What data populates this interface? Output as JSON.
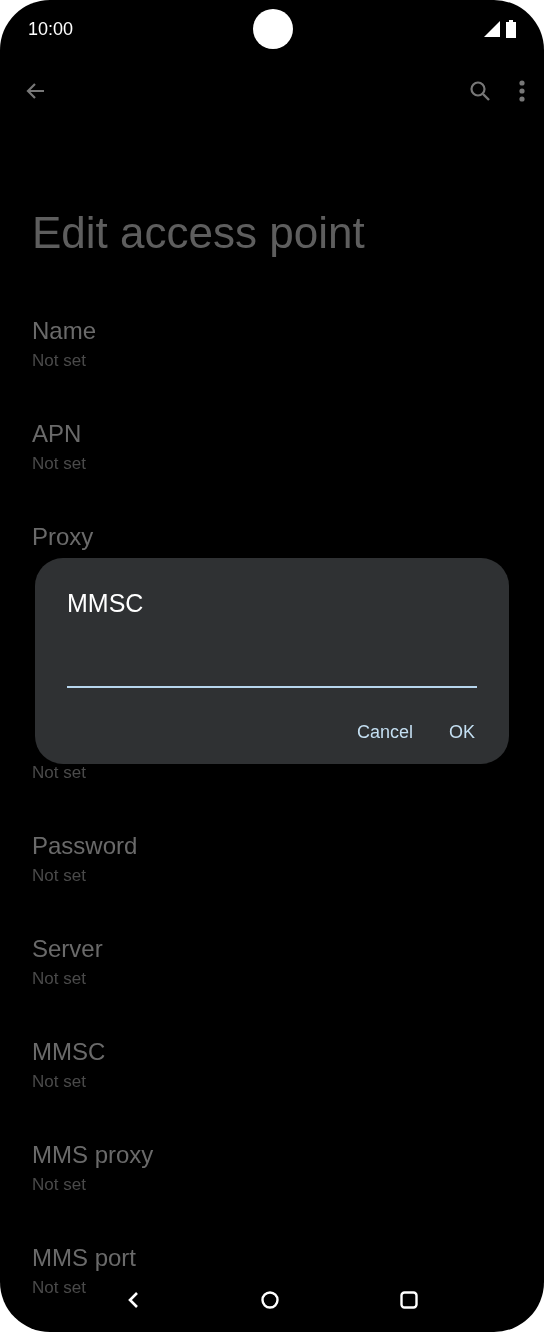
{
  "status_bar": {
    "time": "10:00"
  },
  "title": "Edit access point",
  "settings": [
    {
      "kind": "setting",
      "title": "Name",
      "subtitle": "Not set"
    },
    {
      "kind": "setting",
      "title": "APN",
      "subtitle": "Not set"
    },
    {
      "kind": "setting",
      "title": "Proxy"
    },
    {
      "kind": "covered"
    },
    {
      "kind": "setting",
      "subtitle": "Not set"
    },
    {
      "kind": "setting",
      "title": "Password",
      "subtitle": "Not set"
    },
    {
      "kind": "setting",
      "title": "Server",
      "subtitle": "Not set"
    },
    {
      "kind": "setting",
      "title": "MMSC",
      "subtitle": "Not set"
    },
    {
      "kind": "setting",
      "title": "MMS proxy",
      "subtitle": "Not set"
    },
    {
      "kind": "setting",
      "title": "MMS port",
      "subtitle": "Not set"
    }
  ],
  "dialog": {
    "title": "MMSC",
    "buttons": [
      "Cancel",
      "OK"
    ]
  }
}
